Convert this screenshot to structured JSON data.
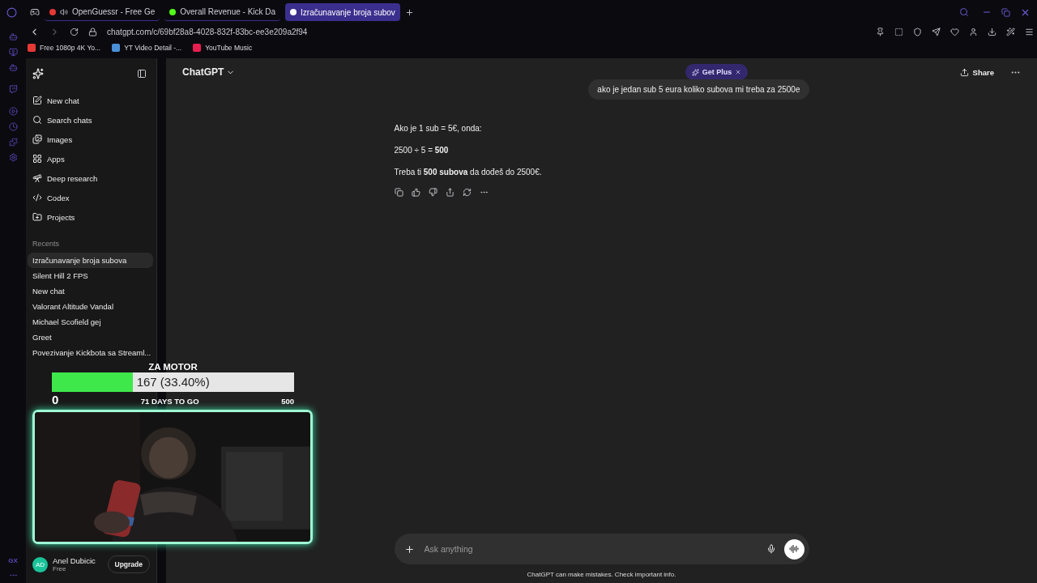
{
  "browser": {
    "tabs": [
      {
        "label": "OpenGuessr - Free Ge",
        "selected": false,
        "audio": true
      },
      {
        "label": "Overall Revenue - Kick Da",
        "selected": false,
        "audio": false
      },
      {
        "label": "Izračunavanje broja subov",
        "selected": true,
        "audio": false
      }
    ],
    "address": "chatgpt.com/c/69bf28a8-4028-832f-83bc-ee3e209a2f94",
    "bookmarks": [
      {
        "label": "Free 1080p 4K Yo...",
        "color": "#e53935"
      },
      {
        "label": "YT Video Detail -...",
        "color": "#4a90d9"
      },
      {
        "label": "YouTube Music",
        "color": "#e91e50"
      }
    ],
    "rail_footer": "GX"
  },
  "sidebar": {
    "nav": [
      {
        "label": "New chat"
      },
      {
        "label": "Search chats"
      },
      {
        "label": "Images"
      },
      {
        "label": "Apps"
      },
      {
        "label": "Deep research"
      },
      {
        "label": "Codex"
      },
      {
        "label": "Projects"
      }
    ],
    "recents_title": "Recents",
    "recents": [
      {
        "label": "Izračunavanje broja subova",
        "selected": true
      },
      {
        "label": "Silent Hill 2 FPS",
        "selected": false
      },
      {
        "label": "New chat",
        "selected": false
      },
      {
        "label": "Valorant Altitude Vandal",
        "selected": false
      },
      {
        "label": "Michael Scofield gej",
        "selected": false
      },
      {
        "label": "Greet",
        "selected": false
      },
      {
        "label": "Povezivanje Kickbota sa Streaml...",
        "selected": false
      }
    ],
    "user": {
      "initials": "AD",
      "name": "Anel Dubicic",
      "plan": "Free",
      "button": "Upgrade"
    }
  },
  "header": {
    "title": "ChatGPT",
    "promo": "Get Plus",
    "share": "Share"
  },
  "conversation": {
    "question": "ako je jedan sub 5 eura koliko subova mi treba za 2500e",
    "answer": [
      "Ako je 1 sub = 5€, onda:",
      "2500 ÷ 5 = **500**",
      "Treba ti **500 subova** da dođeš do 2500€."
    ]
  },
  "composer": {
    "placeholder": "Ask anything",
    "disclaimer": "ChatGPT can make mistakes. Check important info."
  },
  "overlay": {
    "goal": {
      "title": "ZA MOTOR",
      "reading": "167 (33.40%)",
      "level": 0.334,
      "min": "0",
      "max": "500",
      "remaining": "71 DAYS TO GO"
    }
  }
}
